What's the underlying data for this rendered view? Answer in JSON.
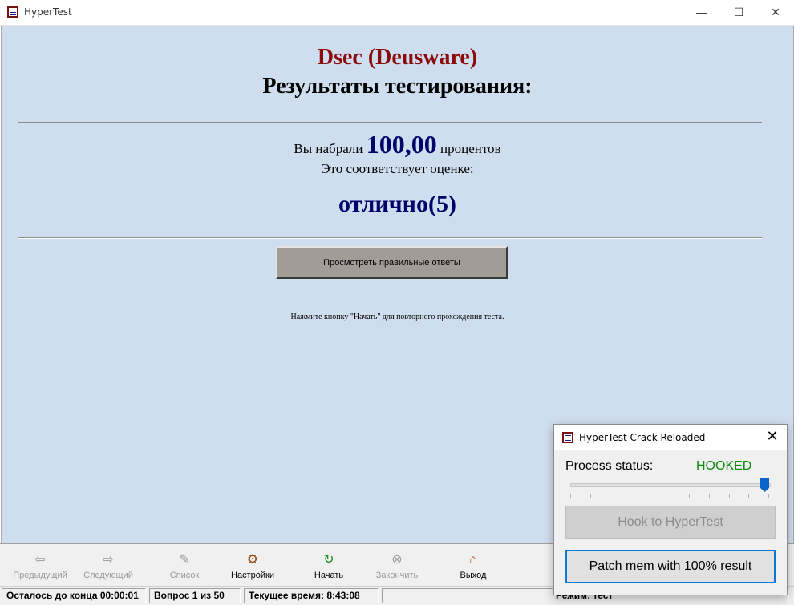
{
  "window": {
    "title": "HyperTest",
    "controls": {
      "minimize": "—",
      "maximize": "☐",
      "close": "✕"
    }
  },
  "results": {
    "brand": "Dsec (Deusware)",
    "heading": "Результаты тестирования:",
    "score_prefix": "Вы набрали",
    "score_value": "100,00",
    "score_suffix": "процентов",
    "grade_note": "Это соответствует оценке:",
    "grade": "отлично(5)",
    "view_answers_button": "Просмотреть правильные ответы",
    "restart_hint": "Нажмите кнопку \"Начать\" для повторного прохождения теста."
  },
  "toolbar": {
    "items": [
      {
        "label": "Предыдущий",
        "icon": "arrow-left-icon",
        "glyph": "⇦",
        "enabled": false
      },
      {
        "label": "Следующий",
        "icon": "arrow-right-icon",
        "glyph": "⇨",
        "enabled": false
      },
      {
        "label": "Список",
        "icon": "list-icon",
        "glyph": "✎",
        "enabled": false
      },
      {
        "label": "Настройки",
        "icon": "settings-icon",
        "glyph": "⚙",
        "enabled": true
      },
      {
        "label": "Начать",
        "icon": "start-icon",
        "glyph": "↻",
        "enabled": true
      },
      {
        "label": "Закончить",
        "icon": "stop-icon",
        "glyph": "⊗",
        "enabled": false
      },
      {
        "label": "Выход",
        "icon": "exit-home-icon",
        "glyph": "⌂",
        "enabled": true
      }
    ]
  },
  "statusbar": {
    "time_left": "Осталось до конца 00:00:01",
    "question": "Вопрос 1 из 50",
    "current_time": "Текущее время: 8:43:08",
    "mode": "Режим: тест"
  },
  "crack_dialog": {
    "title": "HyperTest Crack Reloaded",
    "close": "✕",
    "process_status_label": "Process status:",
    "process_status_value": "HOOKED",
    "status_color": "#0b8a0b",
    "slider_level": 1.0,
    "hook_button": "Hook to HyperTest",
    "hook_enabled": false,
    "patch_button": "Patch mem with 100% result"
  }
}
